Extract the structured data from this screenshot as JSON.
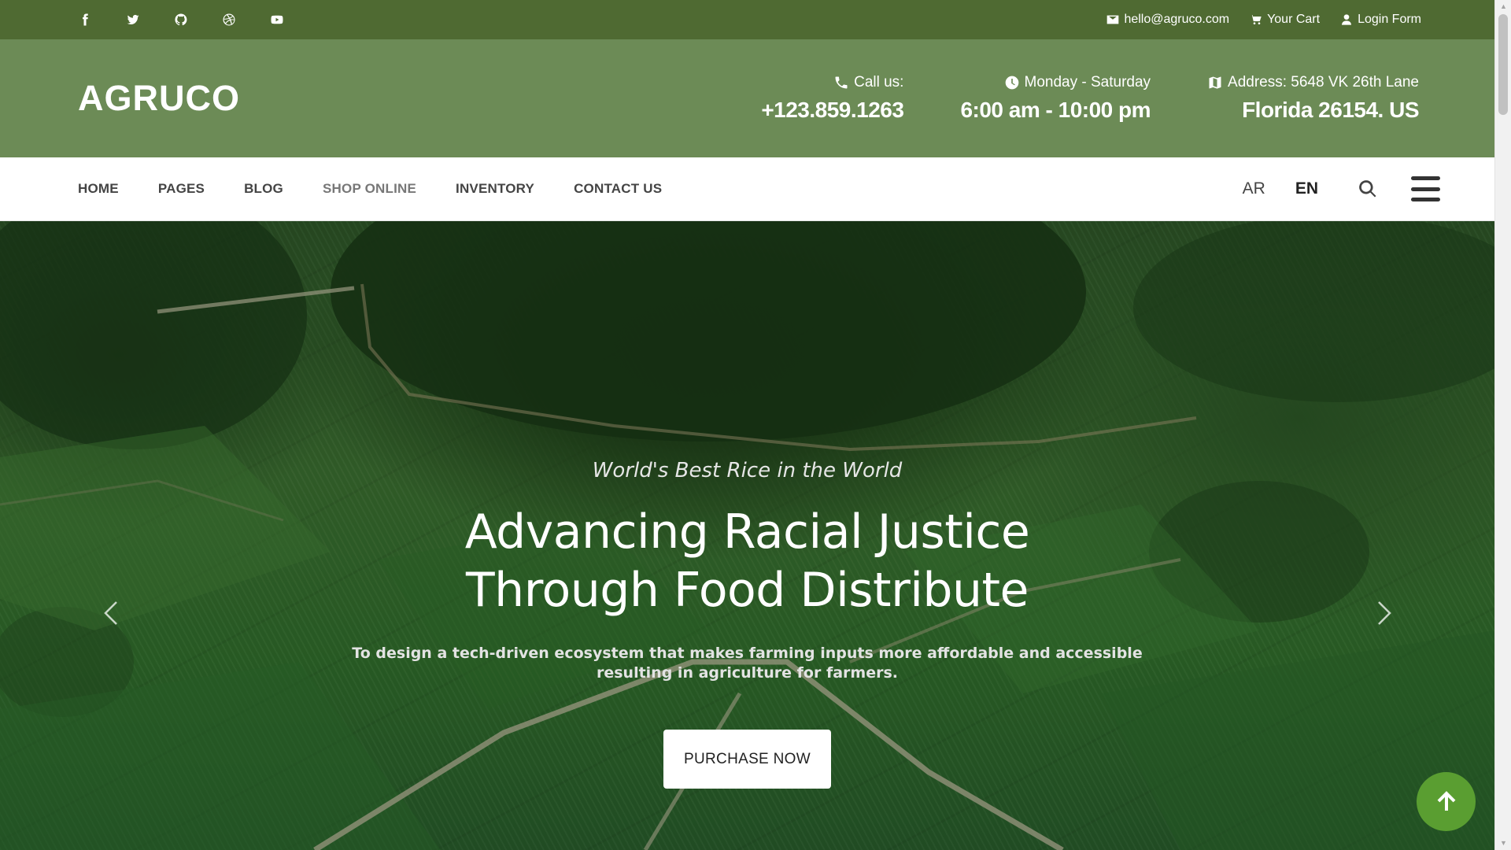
{
  "topbar": {
    "socials": [
      "facebook-icon",
      "twitter-icon",
      "github-icon",
      "dribbble-icon",
      "youtube-icon"
    ],
    "email": "hello@agruco.com",
    "cart": "Your Cart",
    "login": "Login Form"
  },
  "header": {
    "logo": "AGRUCO",
    "call_label": "Call us:",
    "call_value": "+123.859.1263",
    "hours_label": "Monday - Saturday",
    "hours_value": "6:00 am - 10:00 pm",
    "address_label": "Address: 5648 VK 26th Lane",
    "address_value": "Florida 26154. US"
  },
  "nav": {
    "items": [
      "HOME",
      "PAGES",
      "BLOG",
      "SHOP ONLINE",
      "INVENTORY",
      "CONTACT US"
    ],
    "lang_ar": "AR",
    "lang_en": "EN"
  },
  "hero": {
    "eyebrow": "World's Best Rice in the World",
    "headline_line1": "Advancing Racial Justice",
    "headline_line2": "Through Food Distribute",
    "subtitle": "To design a tech-driven ecosystem that makes farming inputs more affordable and accessible resulting in agriculture for farmers.",
    "cta": "PURCHASE NOW"
  },
  "colors": {
    "topbar": "#4f6a32",
    "header": "#6c8b56",
    "accent": "#5a9e31"
  }
}
